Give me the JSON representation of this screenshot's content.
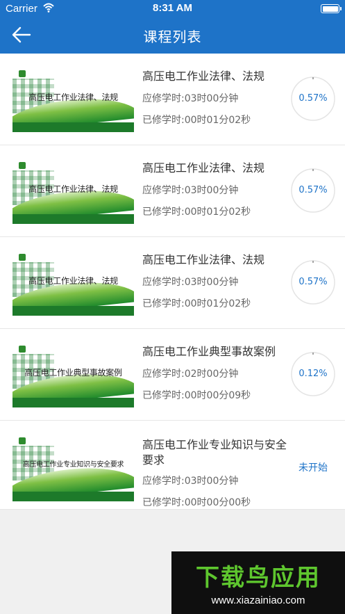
{
  "status_bar": {
    "carrier": "Carrier",
    "time": "8:31 AM"
  },
  "header": {
    "title": "课程列表"
  },
  "courses": [
    {
      "thumb_title": "高压电工作业法律、法规",
      "name": "高压电工作业法律、法规",
      "required": "应修学时:03时00分钟",
      "completed": "已修学时:00时01分02秒",
      "progress": "0.57%",
      "progress_value": 0.0057
    },
    {
      "thumb_title": "高压电工作业法律、法规",
      "name": "高压电工作业法律、法规",
      "required": "应修学时:03时00分钟",
      "completed": "已修学时:00时01分02秒",
      "progress": "0.57%",
      "progress_value": 0.0057
    },
    {
      "thumb_title": "高压电工作业法律、法规",
      "name": "高压电工作业法律、法规",
      "required": "应修学时:03时00分钟",
      "completed": "已修学时:00时01分02秒",
      "progress": "0.57%",
      "progress_value": 0.0057
    },
    {
      "thumb_title": "高压电工作业典型事故案例",
      "name": "高压电工作业典型事故案例",
      "required": "应修学时:02时00分钟",
      "completed": "已修学时:00时00分09秒",
      "progress": "0.12%",
      "progress_value": 0.0012
    },
    {
      "thumb_title": "高压电工作业专业知识与安全要求",
      "name": "高压电工作业专业知识与安全要求",
      "required": "应修学时:03时00分钟",
      "completed": "已修学时:00时00分00秒",
      "status": "未开始"
    }
  ],
  "watermark": {
    "big": "下载鸟应用",
    "url": "www.xiazainiao.com"
  },
  "colors": {
    "header": "#1e73c8",
    "accent": "#1e73c8",
    "thumb_green": "#1d7a2a"
  },
  "icons": {
    "back": "arrow-left-icon",
    "wifi": "wifi-icon",
    "battery": "battery-icon"
  }
}
